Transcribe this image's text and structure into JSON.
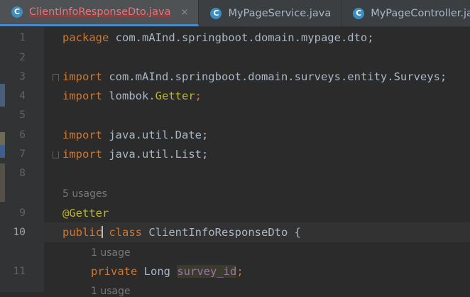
{
  "tabs": [
    {
      "label": "ClientInfoResponseDto.java",
      "icon": "class-icon",
      "active": true
    },
    {
      "label": "MyPageService.java",
      "icon": "class-icon",
      "active": false
    },
    {
      "label": "MyPageController.java",
      "icon": "class-icon",
      "active": false
    }
  ],
  "tab_icon_letter": "C",
  "close_glyph": "×",
  "line_numbers": [
    "1",
    "2",
    "3",
    "4",
    "5",
    "6",
    "7",
    "8",
    "9",
    "10",
    "11"
  ],
  "code": {
    "l1_kw": "package",
    "l1_rest": " com.mAInd.springboot.domain.mypage.dto;",
    "l3_kw": "import",
    "l3_rest": " com.mAInd.springboot.domain.surveys.entity.Surveys;",
    "l4_kw": "import",
    "l4_rest": " lombok.",
    "l4_getter": "Getter",
    "l4_semi": ";",
    "l6_kw": "import",
    "l6_rest": " java.util.Date;",
    "l7_kw": "import",
    "l7_rest": " java.util.List;",
    "usages_class": "5 usages",
    "l9_annotation": "@Getter",
    "l10_kw1_a": "public",
    "l10_kw2": "class",
    "l10_rest": " ClientInfoResponseDto {",
    "usage_field1": "1 usage",
    "l11_kw": "private",
    "l11_type": " Long ",
    "l11_field": "survey_id",
    "l11_semi": ";",
    "usage_field2": "1 usage"
  },
  "colors": {
    "background": "#2b2b2b",
    "keyword": "#cc7832",
    "annotation": "#bbb529",
    "field": "#9876aa",
    "active_tab_text": "#f07178"
  }
}
